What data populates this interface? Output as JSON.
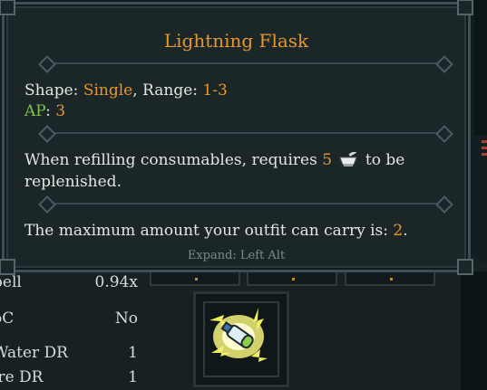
{
  "tooltip": {
    "title": "Lightning Flask",
    "shape_label": "Shape:",
    "shape_value": "Single",
    "range_label": ", Range:",
    "range_value": "1-3",
    "ap_label": "AP",
    "ap_sep": ":",
    "ap_value": "3",
    "refill_text_before": "When refilling consumables, requires",
    "refill_amount": "5",
    "refill_icon": "mortar-pestle-icon",
    "refill_text_after": "to be",
    "refill_text_line2": "replenished.",
    "carry_text": "The maximum amount your outfit can carry is:",
    "carry_value": "2",
    "carry_end": ".",
    "expand_hint": "Expand: Left Alt"
  },
  "stats": [
    {
      "label": "pell",
      "value": "0.94x"
    },
    {
      "label": "oC",
      "value": "No"
    },
    {
      "label": "Water DR",
      "value": "1"
    },
    {
      "label": "ire DR",
      "value": "1"
    }
  ],
  "item_slot": {
    "icon": "lightning-flask-icon"
  },
  "colors": {
    "accent": "#e8962a",
    "ap": "#7fc24a",
    "panel": "#1b2629",
    "border": "#3f4e52"
  }
}
